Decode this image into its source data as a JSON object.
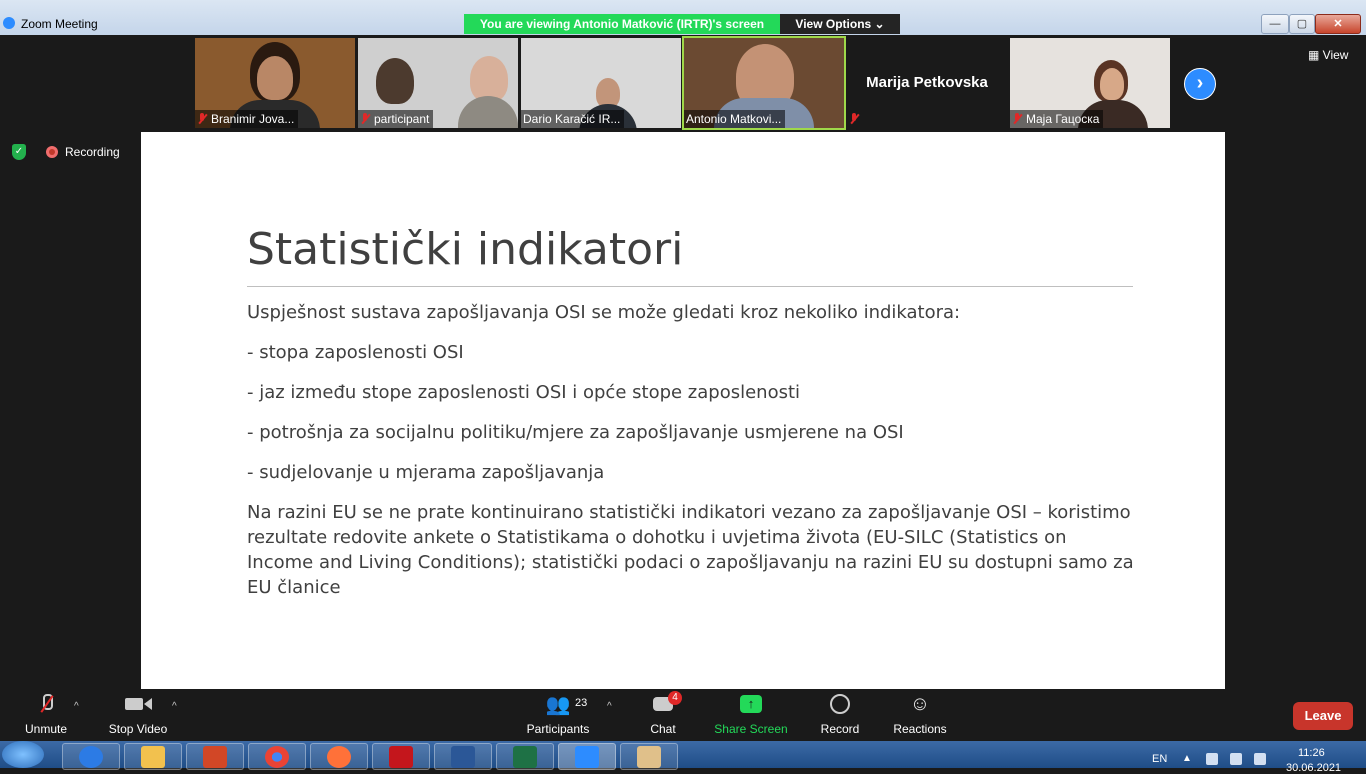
{
  "window": {
    "title": "Zoom Meeting",
    "viewing_banner": "You are viewing Antonio Matković (IRTR)'s screen",
    "view_options": "View Options ⌄",
    "min": "—",
    "max": "▢",
    "close": "✕"
  },
  "gallery": {
    "tiles": [
      {
        "name": "Branimir Jova...",
        "muted": true
      },
      {
        "name": "participant",
        "muted": true
      },
      {
        "name": "Dario Karačić IR...",
        "muted": false
      },
      {
        "name": "Antonio Matkovi...",
        "muted": false,
        "active_speaker": true
      },
      {
        "name": "Marija Petkovska",
        "muted": true,
        "video_off": true
      },
      {
        "name": "Maja Гацоска",
        "muted": true
      }
    ],
    "next_icon": "›",
    "view_label": "View"
  },
  "recording": {
    "label": "Recording"
  },
  "slide": {
    "title": "Statistički indikatori",
    "lines": [
      "Uspješnost sustava zapošljavanja OSI se može gledati kroz nekoliko indikatora:",
      "- stopa zaposlenosti OSI",
      "- jaz između stope zaposlenosti OSI i opće stope zaposlenosti",
      "- potrošnja za socijalnu politiku/mjere za zapošljavanje usmjerene na OSI",
      "- sudjelovanje u mjerama zapošljavanja"
    ],
    "paragraph": "Na razini EU se ne prate kontinuirano statistički indikatori vezano za zapošljavanje OSI – koristimo rezultate redovite ankete o Statistikama o dohotku i uvjetima života (EU-SILC (Statistics on Income and Living Conditions); statistički podaci o zapošljavanju na razini EU su dostupni samo za EU članice"
  },
  "toolbar": {
    "unmute": "Unmute",
    "stop_video": "Stop Video",
    "participants": "Participants",
    "participants_count": "23",
    "chat": "Chat",
    "chat_badge": "4",
    "share_screen": "Share Screen",
    "record": "Record",
    "reactions": "Reactions",
    "leave": "Leave"
  },
  "taskbar": {
    "lang": "EN",
    "time": "11:26",
    "date": "30.06.2021"
  },
  "colors": {
    "accent_blue": "#2d8cff",
    "share_green": "#23d959",
    "leave_red": "#c8352b"
  }
}
